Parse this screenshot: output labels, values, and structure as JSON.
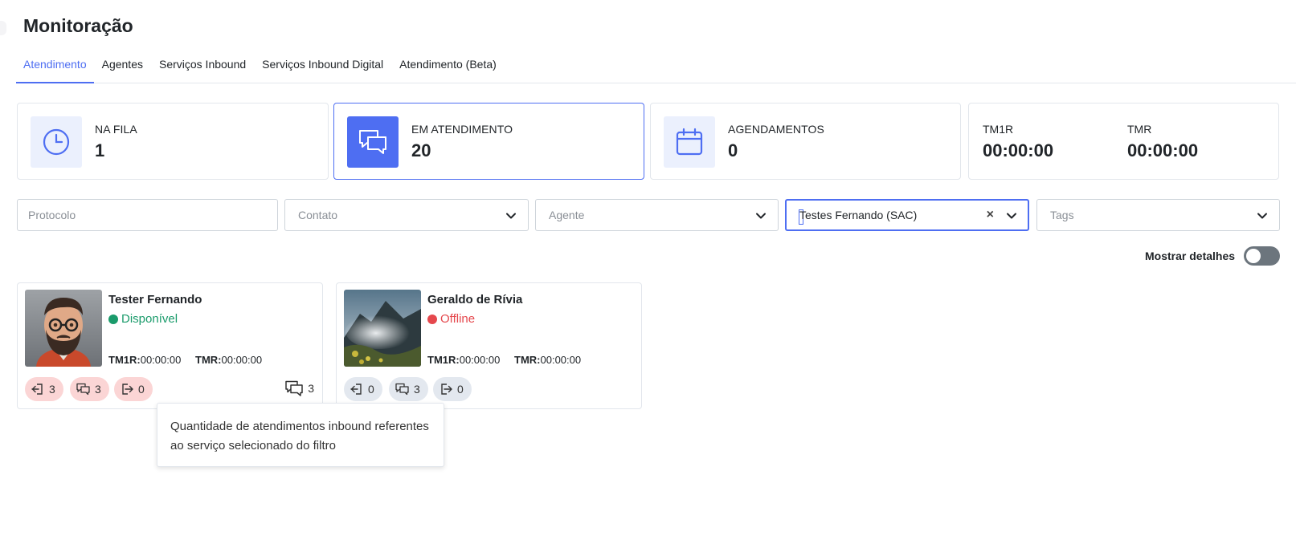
{
  "page": {
    "title": "Monitoração"
  },
  "tabs": [
    {
      "label": "Atendimento",
      "active": true
    },
    {
      "label": "Agentes",
      "active": false
    },
    {
      "label": "Serviços Inbound",
      "active": false
    },
    {
      "label": "Serviços Inbound Digital",
      "active": false
    },
    {
      "label": "Atendimento (Beta)",
      "active": false
    }
  ],
  "stats": {
    "queue": {
      "label": "NA FILA",
      "value": "1",
      "icon": "clock-icon"
    },
    "in_service": {
      "label": "EM ATENDIMENTO",
      "value": "20",
      "icon": "chat-bubbles-icon",
      "selected": true
    },
    "schedules": {
      "label": "AGENDAMENTOS",
      "value": "0",
      "icon": "calendar-icon"
    },
    "times": {
      "tm1r_label": "TM1R",
      "tm1r_value": "00:00:00",
      "tmr_label": "TMR",
      "tmr_value": "00:00:00"
    }
  },
  "filters": {
    "protocol": {
      "placeholder": "Protocolo"
    },
    "contact": {
      "placeholder": "Contato"
    },
    "agent": {
      "placeholder": "Agente"
    },
    "service": {
      "value": "Testes Fernando (SAC)"
    },
    "tags": {
      "placeholder": "Tags"
    }
  },
  "details_toggle": {
    "label": "Mostrar detalhes",
    "on": false
  },
  "agents": [
    {
      "name": "Tester Fernando",
      "status": "Disponível",
      "status_color": "#1a9b6b",
      "tm1r_label": "TM1R:",
      "tm1r": "00:00:00",
      "tmr_label": "TMR:",
      "tmr": "00:00:00",
      "counts": {
        "inbound": "3",
        "chat": "3",
        "outbound": "0"
      },
      "total_chats": "3"
    },
    {
      "name": "Geraldo de Rívia",
      "status": "Offline",
      "status_color": "#e5484d",
      "tm1r_label": "TM1R:",
      "tm1r": "00:00:00",
      "tmr_label": "TMR:",
      "tmr": "00:00:00",
      "counts": {
        "inbound": "0",
        "chat": "3",
        "outbound": "0"
      }
    }
  ],
  "tooltip": {
    "text": "Quantidade de atendimentos inbound referentes ao serviço selecionado do filtro"
  },
  "colors": {
    "accent": "#4e6ef2",
    "pill_red": "#fbd5d5",
    "pill_gray": "#e3e8ef"
  }
}
